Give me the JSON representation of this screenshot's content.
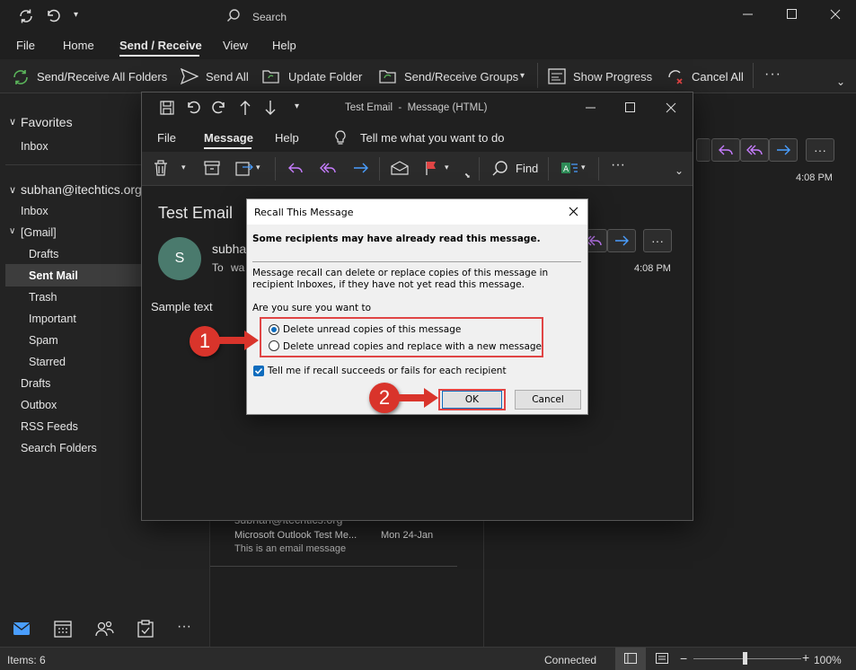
{
  "main": {
    "search_placeholder": "Search",
    "menu": [
      "File",
      "Home",
      "Send / Receive",
      "View",
      "Help"
    ],
    "ribbon": {
      "send_receive_all": "Send/Receive All Folders",
      "send_all": "Send All",
      "update_folder": "Update Folder",
      "send_receive_groups": "Send/Receive Groups",
      "show_progress": "Show Progress",
      "cancel_all": "Cancel All"
    },
    "nav": {
      "favorites": "Favorites",
      "fav_inbox": "Inbox",
      "account": "subhan@itechtics.org",
      "inbox": "Inbox",
      "gmail": "[Gmail]",
      "drafts_g": "Drafts",
      "sent_mail": "Sent Mail",
      "trash": "Trash",
      "important": "Important",
      "spam": "Spam",
      "starred": "Starred",
      "drafts": "Drafts",
      "outbox": "Outbox",
      "rss": "RSS Feeds",
      "search_folders": "Search Folders"
    },
    "list_item": {
      "from": "subhan@itechtics.org",
      "subject": "Microsoft Outlook Test Me...",
      "date": "Mon 24-Jan",
      "preview": "This is an email message"
    },
    "reading_time": "4:08 PM",
    "status": {
      "items": "Items: 6",
      "connected": "Connected",
      "zoom": "100%"
    }
  },
  "message": {
    "title": "Test Email  -  Message (HTML)",
    "menu": {
      "file": "File",
      "message": "Message",
      "help": "Help",
      "tell_me": "Tell me what you want to do"
    },
    "find": "Find",
    "subject": "Test Email",
    "avatar_letter": "S",
    "sender": "subhan",
    "to_label": "To",
    "to_value": "wa",
    "time": "4:08 PM",
    "body": "Sample text"
  },
  "dialog": {
    "title": "Recall This Message",
    "warning": "Some recipients may have already read this message.",
    "description": "Message recall can delete or replace copies of this message in recipient Inboxes, if they have not yet read this message.",
    "question": "Are you sure you want to",
    "option1": "Delete unread copies of this message",
    "option2": "Delete unread copies and replace with a new message",
    "checkbox": "Tell me if recall succeeds or fails for each recipient",
    "ok": "OK",
    "cancel": "Cancel"
  },
  "annotations": {
    "step1": "1",
    "step2": "2"
  },
  "colors": {
    "accent": "#0f6cbd",
    "highlight": "#e04545",
    "badge": "#d9342b"
  }
}
